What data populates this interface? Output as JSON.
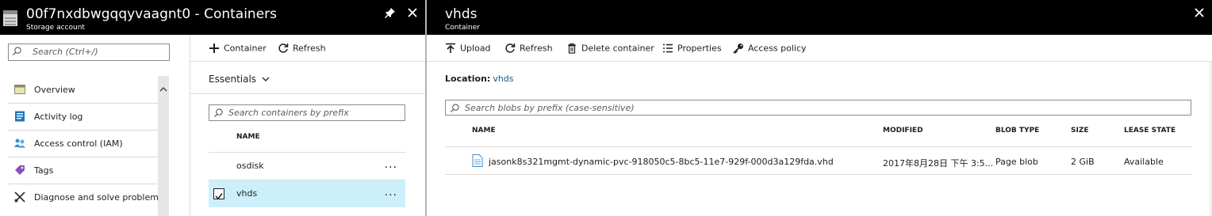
{
  "storage": {
    "title": "00f7nxdbwgqqyvaagnt0 - Containers",
    "subtitle": "Storage account",
    "search_placeholder": "Search (Ctrl+/)",
    "menu": [
      {
        "label": "Overview",
        "icon": "overview-icon"
      },
      {
        "label": "Activity log",
        "icon": "activity-log-icon"
      },
      {
        "label": "Access control (IAM)",
        "icon": "iam-icon"
      },
      {
        "label": "Tags",
        "icon": "tag-icon"
      },
      {
        "label": "Diagnose and solve problems",
        "icon": "wrench-icon"
      }
    ]
  },
  "containers": {
    "toolbar": {
      "add_label": "Container",
      "refresh_label": "Refresh"
    },
    "essentials_label": "Essentials",
    "search_placeholder": "Search containers by prefix",
    "name_header": "NAME",
    "rows": [
      {
        "name": "osdisk",
        "selected": false
      },
      {
        "name": "vhds",
        "selected": true
      }
    ],
    "more_glyph": "..."
  },
  "container_blade": {
    "title": "vhds",
    "subtitle": "Container",
    "toolbar": {
      "upload_label": "Upload",
      "refresh_label": "Refresh",
      "delete_label": "Delete container",
      "properties_label": "Properties",
      "access_policy_label": "Access policy"
    },
    "location_label": "Location:",
    "location_value": "vhds",
    "search_placeholder": "Search blobs by prefix (case-sensitive)",
    "columns": {
      "name": "NAME",
      "modified": "MODIFIED",
      "blob_type": "BLOB TYPE",
      "size": "SIZE",
      "lease_state": "LEASE STATE"
    },
    "blobs": [
      {
        "name": "jasonk8s321mgmt-dynamic-pvc-918050c5-8bc5-11e7-929f-000d3a129fda.vhd",
        "modified": "2017年8月28日 下午 3:5...",
        "blob_type": "Page blob",
        "size": "2 GiB",
        "lease_state": "Available"
      }
    ]
  },
  "colors": {
    "header_bg": "#000000",
    "selected_row": "#cdeffb",
    "link": "#0b5e92"
  }
}
